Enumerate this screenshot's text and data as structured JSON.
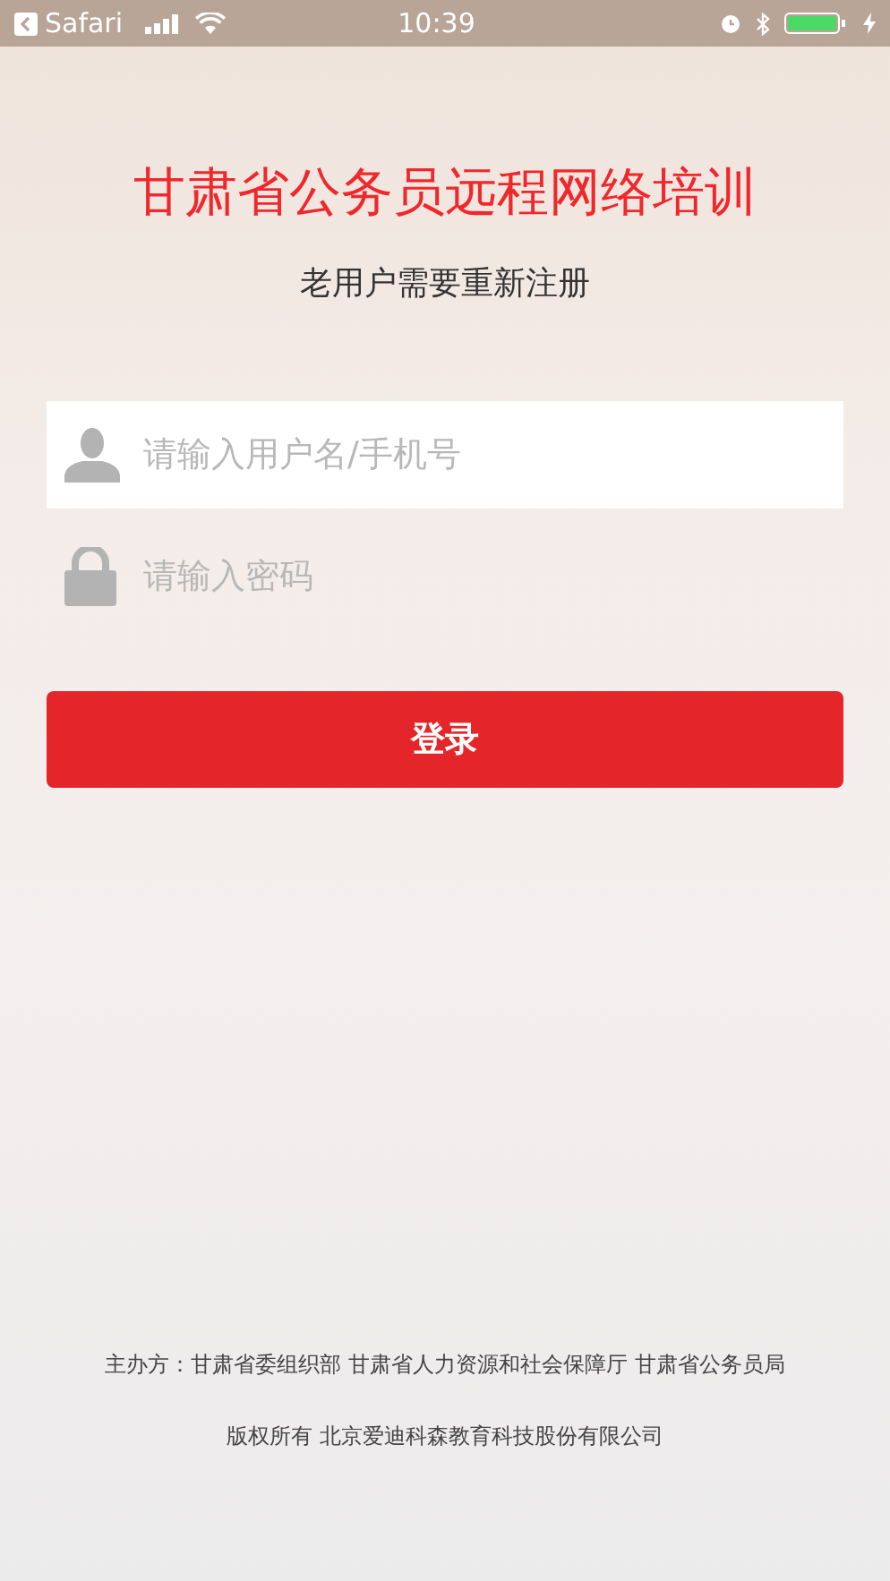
{
  "status_bar": {
    "back_app": "Safari",
    "time": "10:39"
  },
  "title": "甘肃省公务员远程网络培训",
  "subtitle": "老用户需要重新注册",
  "fields": [
    {
      "kind": "user",
      "placeholder": "请输入用户名/手机号",
      "focused": true
    },
    {
      "kind": "password",
      "placeholder": "请输入密码",
      "focused": false
    }
  ],
  "login_button": "登录",
  "footer": [
    "主办方：甘肃省委组织部 甘肃省人力资源和社会保障厅 甘肃省公务员局",
    "版权所有 北京爱迪科森教育科技股份有限公司"
  ]
}
